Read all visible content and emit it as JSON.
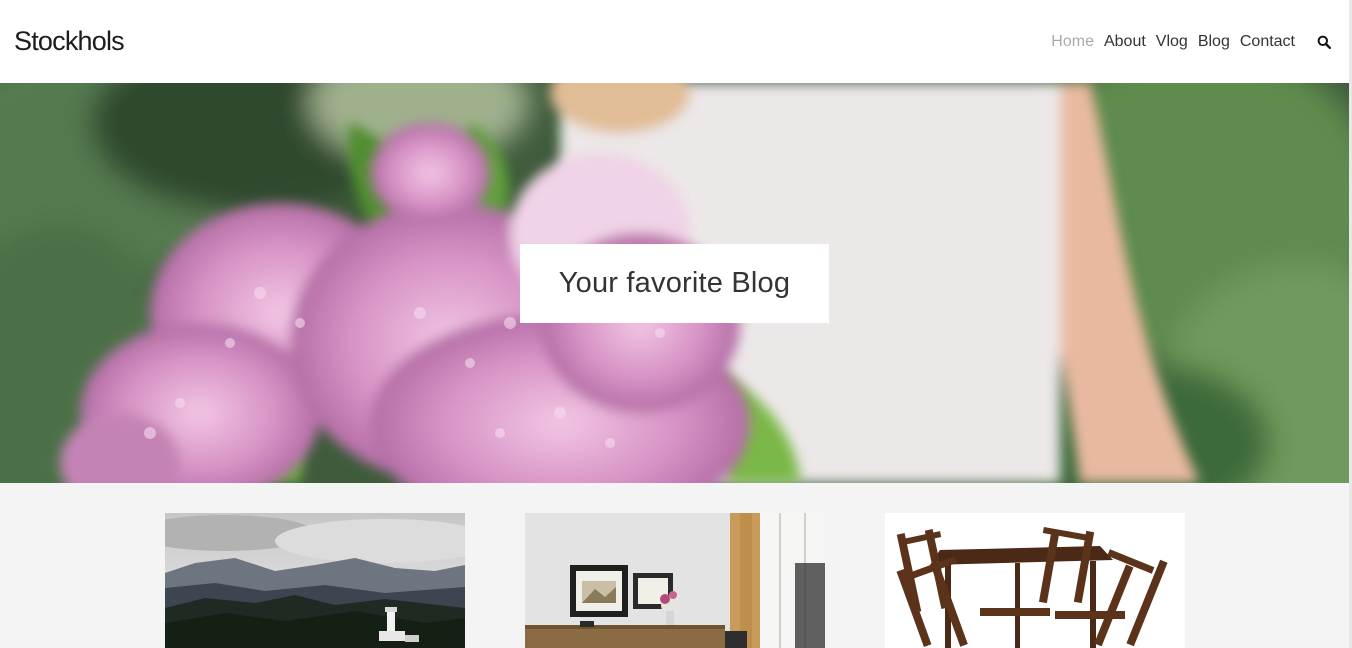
{
  "site": {
    "logo": "Stockhols"
  },
  "nav": {
    "items": [
      {
        "label": "Home",
        "active": true
      },
      {
        "label": "About",
        "active": false
      },
      {
        "label": "Vlog",
        "active": false
      },
      {
        "label": "Blog",
        "active": false
      },
      {
        "label": "Contact",
        "active": false
      }
    ],
    "search_icon": "search-icon"
  },
  "hero": {
    "caption": "Your favorite Blog",
    "image": "woman-holding-pink-hydrangea-bouquet"
  },
  "posts": [
    {
      "image": "mountain-lighthouse-landscape"
    },
    {
      "image": "home-office-desk-interior"
    },
    {
      "image": "wooden-folding-table-and-chairs"
    }
  ],
  "colors": {
    "header_bg": "#ffffff",
    "page_bg": "#f4f4f4",
    "nav_text": "#333333",
    "nav_active": "#aaaaaa",
    "hydrangea_pink": "#d48cbf",
    "foliage_green": "#3e6a3a"
  }
}
